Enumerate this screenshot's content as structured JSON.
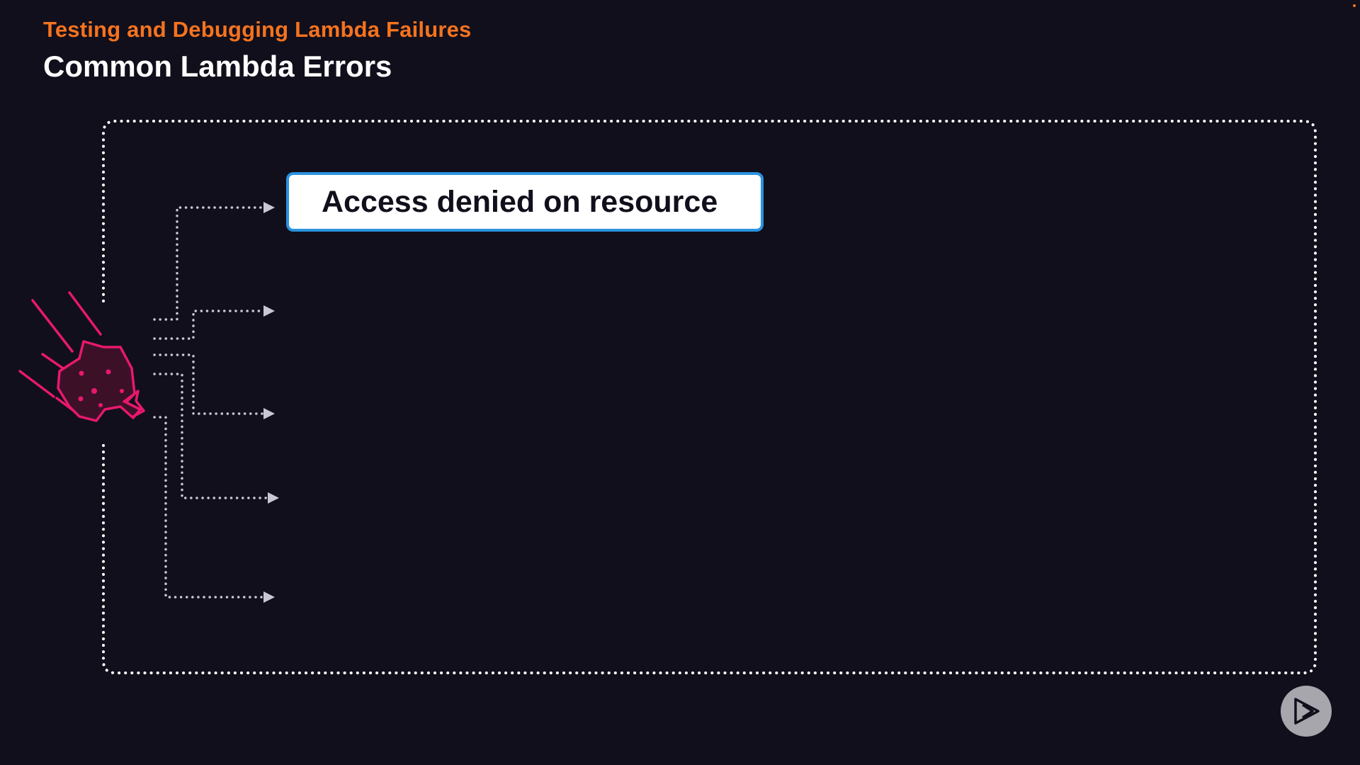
{
  "header": {
    "section": "Testing and Debugging Lambda Failures",
    "title": "Common Lambda Errors"
  },
  "diagram": {
    "errors": [
      {
        "label": "Access denied on resource",
        "visible": true
      },
      {
        "label": "",
        "visible": false
      },
      {
        "label": "",
        "visible": false
      },
      {
        "label": "",
        "visible": false
      },
      {
        "label": "",
        "visible": false
      }
    ],
    "source_icon": "crashing-lambda-rock-icon"
  },
  "player": {
    "play_icon": "play-logo-icon"
  },
  "colors": {
    "background": "#110f1b",
    "accent_orange": "#f5731f",
    "box_border_blue": "#2a93df",
    "icon_pink": "#e8186d",
    "connector_gray": "#c9c7d2",
    "frame_white": "#ffffff"
  }
}
